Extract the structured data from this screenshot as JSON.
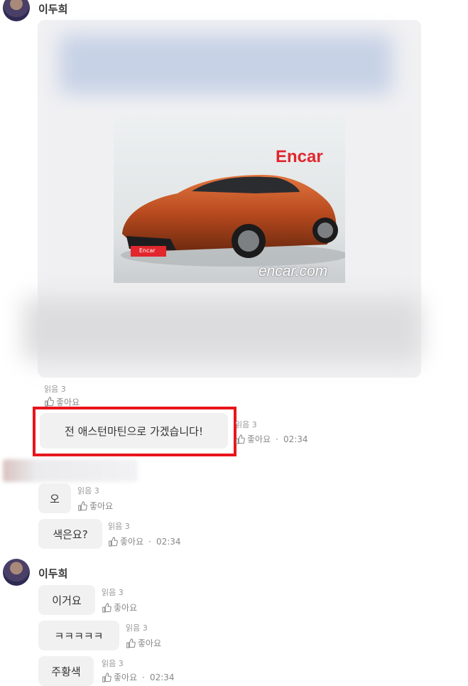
{
  "messages": {
    "top_sender": "이두희",
    "bottom_sender": "이두희",
    "read_label": "읽음 3",
    "like_label": "좋아요",
    "time": "02:34",
    "dot": "·",
    "image_watermark": "Encar",
    "image_watermark_url": "encar.com",
    "plate_text": "Encar",
    "bubble_highlight": "전 애스턴마틴으로 가겠습니다!",
    "bubble_o": "오",
    "bubble_color": "색은요?",
    "bubble_this": "이거요",
    "bubble_kkk": "ㅋㅋㅋㅋㅋ",
    "bubble_orange": "주황색"
  },
  "colors": {
    "highlight_border": "#e8141c",
    "car_body": "#b84a1e",
    "encar_red": "#e1262d"
  }
}
